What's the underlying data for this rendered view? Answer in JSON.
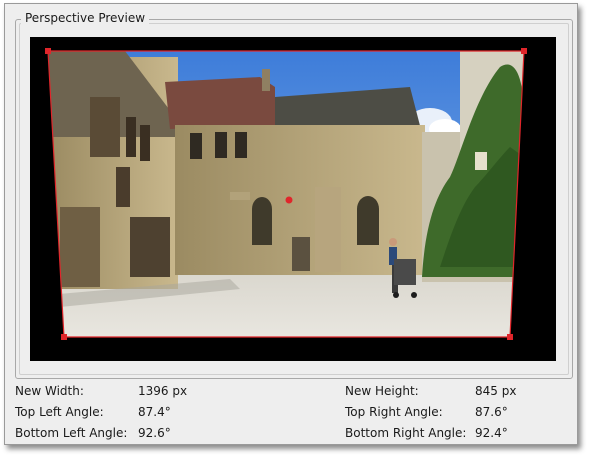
{
  "panel": {
    "title": "Perspective Preview"
  },
  "preview": {
    "image_alt": "Photo of a stone courtyard with an old manor building, ivy-covered wall, and a person pushing a stroller",
    "frame_color": "#e0262b",
    "center_marker_color": "#e0262b"
  },
  "info": {
    "new_width": {
      "label": "New Width:",
      "value": "1396 px"
    },
    "new_height": {
      "label": "New Height:",
      "value": "845 px"
    },
    "top_left_angle": {
      "label": "Top Left Angle:",
      "value": "87.4°"
    },
    "top_right_angle": {
      "label": "Top Right Angle:",
      "value": "87.6°"
    },
    "bottom_left_angle": {
      "label": "Bottom Left Angle:",
      "value": "92.6°"
    },
    "bottom_right_angle": {
      "label": "Bottom Right Angle:",
      "value": "92.4°"
    }
  }
}
